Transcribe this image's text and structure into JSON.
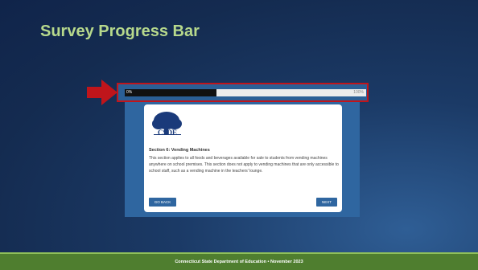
{
  "slide": {
    "title": "Survey Progress Bar"
  },
  "progress": {
    "start_label": "0%",
    "end_label": "100%",
    "value_percent": 38
  },
  "card": {
    "logo_text": "CSDE",
    "section_title": "Section 6: Vending Machines",
    "section_body": "This section applies to all foods and beverages available for sale to students from vending machines anywhere on school premises. This section does not apply to vending machines that are only accessible to school staff, such as a vending machine in the teachers' lounge.",
    "back_label": "GO BACK",
    "next_label": "NEXT"
  },
  "footer": {
    "text": "Connecticut State Department of Education • November 2023"
  },
  "colors": {
    "title": "#b7d98c",
    "highlight": "#c0151b",
    "footer": "#4f7e2f",
    "button": "#2f66a0"
  },
  "icons": {
    "arrow": "red-arrow-icon",
    "logo": "csde-tree-logo"
  }
}
